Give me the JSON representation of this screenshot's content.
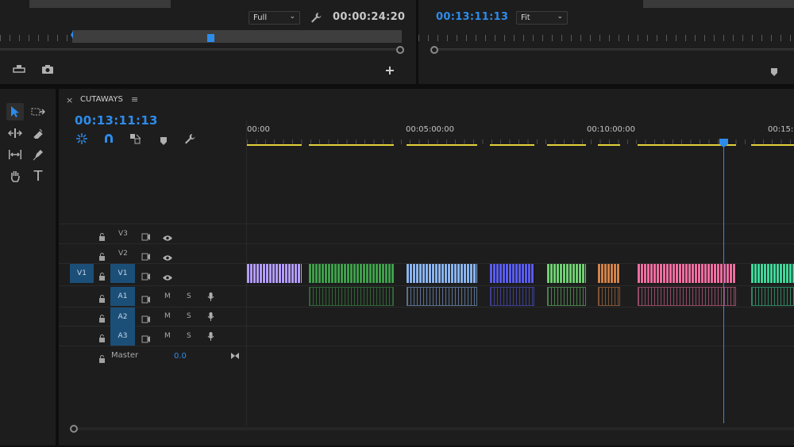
{
  "source_monitor": {
    "resolution": "Full",
    "timecode": "00:00:24:20",
    "add_icon": "plus-icon",
    "export_icon": "export-frame-icon",
    "camera_icon": "camera-icon"
  },
  "program_monitor": {
    "timecode": "00:13:11:13",
    "zoom": "Fit",
    "marker_icon": "marker-icon"
  },
  "timeline": {
    "sequence_name": "CUTAWAYS",
    "close_label": "×",
    "menu_label": "≡",
    "timecode": "00:13:11:13",
    "ruler": [
      "00:00",
      "00:05:00:00",
      "00:10:00:00",
      "00:15:"
    ],
    "tracks": {
      "v3": "V3",
      "v2": "V2",
      "v1_src": "V1",
      "v1": "V1",
      "a1": "A1",
      "a2": "A2",
      "a3": "A3",
      "mute": "M",
      "solo": "S",
      "master_label": "Master",
      "master_value": "0.0"
    },
    "clip_colors": {
      "lavender": "#b49cff",
      "green": "#3f9f4c",
      "lightblue": "#8ab4f0",
      "blue": "#5a5cf0",
      "lightgreen": "#6fcf72",
      "orange": "#d2824a",
      "pink": "#f06ea0",
      "teal": "#3fd79a"
    },
    "accent_color": "#2d8ceb",
    "playhead_color": "#2d8ceb"
  },
  "tools": [
    "selection-tool",
    "track-select-tool",
    "ripple-edit-tool",
    "razor-tool",
    "slip-tool",
    "pen-tool",
    "hand-tool",
    "type-tool"
  ]
}
